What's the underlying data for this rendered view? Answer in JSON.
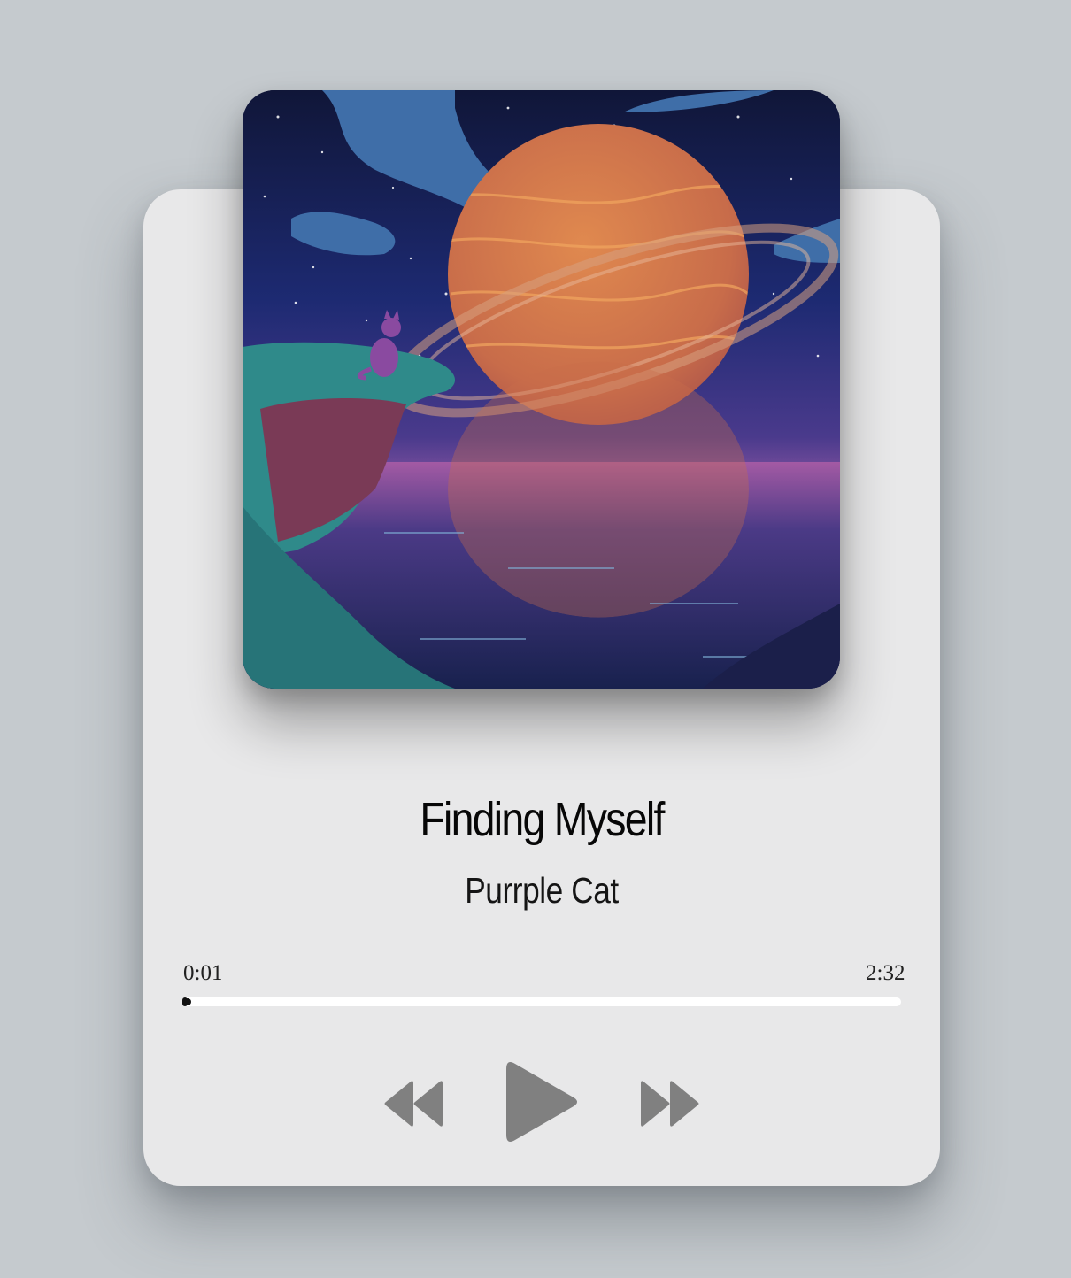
{
  "track": {
    "title": "Finding Myself",
    "artist": "Purrple Cat"
  },
  "playback": {
    "current_time": "0:01",
    "total_time": "2:32",
    "progress_fraction": 0.007
  },
  "controls": {
    "prev_icon": "rewind-icon",
    "play_icon": "play-icon",
    "next_icon": "fast-forward-icon"
  },
  "colors": {
    "page_background": "#c5cace",
    "card_background": "#e8e8e9",
    "control_icon": "#808080",
    "progress_track": "#ffffff",
    "progress_fill": "#111111"
  }
}
